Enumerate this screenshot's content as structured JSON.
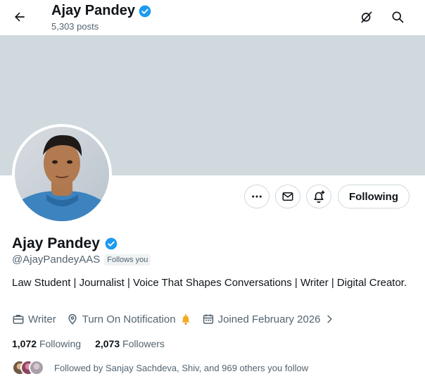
{
  "header": {
    "name": "Ajay Pandey",
    "posts": "5,303 posts"
  },
  "actions": {
    "following_label": "Following"
  },
  "profile": {
    "name": "Ajay Pandey",
    "handle": "@AjayPandeyAAS",
    "follows_you": "Follows you",
    "bio": "Law Student | Journalist | Voice That Shapes Conversations | Writer | Digital Creator."
  },
  "meta": {
    "category": "Writer",
    "location": "Turn On Notification",
    "joined": "Joined February 2026"
  },
  "counts": {
    "following_value": "1,072",
    "following_label": "Following",
    "followers_value": "2,073",
    "followers_label": "Followers"
  },
  "followed_by": "Followed by Sanjay Sachdeva, Shiv, and 969 others you follow",
  "colors": {
    "verified": "#1d9bf0",
    "banner": "#cfd9de",
    "bell": "#f4a91e",
    "secondary_text": "#536471"
  }
}
